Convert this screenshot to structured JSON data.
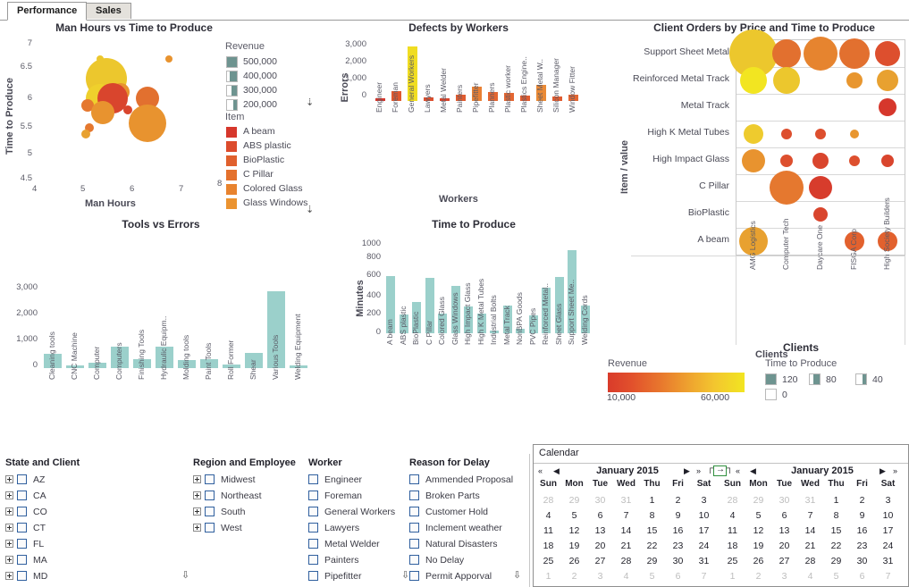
{
  "tabs": [
    {
      "label": "Performance",
      "active": true
    },
    {
      "label": "Sales",
      "active": false
    }
  ],
  "charts": {
    "bubble_scatter": {
      "title": "Man Hours vs Time to Produce",
      "xlabel": "Man Hours",
      "ylabel": "Time to Produce",
      "xticks": [
        "4",
        "5",
        "6",
        "7",
        "8"
      ],
      "yticks": [
        "7",
        "6.5",
        "6",
        "5.5",
        "5",
        "4.5"
      ],
      "legend_revenue_title": "Revenue",
      "legend_revenue": [
        "500,000",
        "400,000",
        "300,000",
        "200,000"
      ],
      "legend_item_title": "Item",
      "legend_items": [
        {
          "label": "A beam",
          "color": "#d6372c"
        },
        {
          "label": "ABS plastic",
          "color": "#dc4b2c"
        },
        {
          "label": "BioPlastic",
          "color": "#e0602d"
        },
        {
          "label": "C Pillar",
          "color": "#e4712d"
        },
        {
          "label": "Colored Glass",
          "color": "#e8832e"
        },
        {
          "label": "Glass Windows",
          "color": "#eb9330"
        }
      ]
    },
    "defects": {
      "title": "Defects by Workers",
      "xlabel": "Workers",
      "ylabel": "Errors",
      "yticks": [
        "3,000",
        "2,000",
        "1,000",
        "0"
      ],
      "categories": [
        "Engineer",
        "Foreman",
        "General Workers",
        "Lawyers",
        "Metal Welder",
        "Painters",
        "Pipefitter",
        "Planners",
        "Plastic worker",
        "Plastics Engine..",
        "Sheet Metal W..",
        "Silicon Manager",
        "Window Fitter"
      ],
      "values": [
        130,
        500,
        2880,
        190,
        140,
        330,
        750,
        480,
        440,
        300,
        840,
        220,
        330
      ],
      "colors": [
        "#d6372c",
        "#df5930",
        "#f0dd22",
        "#dd4f2e",
        "#d9452d",
        "#e05c30",
        "#e98034",
        "#e36632",
        "#e36632",
        "#e05c30",
        "#ea8a36",
        "#e05c30",
        "#e36632"
      ]
    },
    "tools": {
      "title": "Tools vs Errors",
      "yticks": [
        "3,000",
        "2,000",
        "1,000",
        "0"
      ],
      "categories": [
        "Cleaning tools",
        "CNC Machine",
        "Computer",
        "Computers",
        "Finishing Tools",
        "Hydraulic Equipm..",
        "Molding tools",
        "Paint Tools",
        "Roll Former",
        "Shear",
        "Various Tools",
        "Welding Equipment"
      ],
      "values": [
        540,
        60,
        210,
        780,
        330,
        780,
        290,
        330,
        120,
        550,
        2840,
        70
      ],
      "color": "#9bd0cb"
    },
    "time_to_produce": {
      "title": "Time to Produce",
      "ylabel": "Minutes",
      "yticks": [
        "1000",
        "800",
        "600",
        "400",
        "200",
        "0"
      ],
      "categories": [
        "A beam",
        "ABS plastic",
        "BioPlastic",
        "C Pillar",
        "Colored Glass",
        "Glass Windows",
        "High Impact Glass",
        "High K Metal Tubes",
        "Industrial Bolts",
        "Metal Track",
        "NonBPA Goods",
        "PVC Pipes",
        "Reinforced Metal..",
        "Sheet Glass",
        "Support Sheet Me..",
        "Welding Cords"
      ],
      "values": [
        620,
        200,
        335,
        605,
        215,
        510,
        290,
        215,
        30,
        300,
        50,
        190,
        500,
        615,
        900,
        300
      ],
      "color": "#9bd0cb"
    },
    "client_matrix": {
      "title": "Client Orders by Price and Time to Produce",
      "ylabel": "Item / value",
      "xlabel": "Clients",
      "rows": [
        "Support Sheet Metal",
        "Reinforced Metal Track",
        "Metal Track",
        "High K Metal Tubes",
        "High Impact Glass",
        "C Pillar",
        "BioPlastic",
        "A beam"
      ],
      "columns": [
        "AMG Logistics",
        "Computer Tech",
        "Daycare One",
        "FISGA Corp",
        "High Society Builders"
      ],
      "cells": [
        [
          {
            "r": 27,
            "c": "#ecc72d"
          },
          {
            "r": 16,
            "c": "#e2702f"
          },
          {
            "r": 19,
            "c": "#e6842f"
          },
          {
            "r": 17,
            "c": "#e2702f"
          },
          {
            "r": 14,
            "c": "#dd4f2e"
          }
        ],
        [
          {
            "r": 15,
            "c": "#f2e521"
          },
          {
            "r": 15,
            "c": "#ecc72d"
          },
          null,
          {
            "r": 9,
            "c": "#e8962f"
          },
          {
            "r": 12,
            "c": "#e8a130"
          }
        ],
        [
          null,
          null,
          null,
          null,
          {
            "r": 10,
            "c": "#d6372c"
          }
        ],
        [
          {
            "r": 11,
            "c": "#eecb2e"
          },
          {
            "r": 6,
            "c": "#dd4f2e"
          },
          {
            "r": 6,
            "c": "#dd4f2e"
          },
          {
            "r": 5,
            "c": "#e8962f"
          },
          null
        ],
        [
          {
            "r": 13,
            "c": "#e8932f"
          },
          {
            "r": 7,
            "c": "#dd4f2e"
          },
          {
            "r": 9,
            "c": "#d9452d"
          },
          {
            "r": 6,
            "c": "#dd4f2e"
          },
          {
            "r": 7,
            "c": "#d9452d"
          }
        ],
        [
          null,
          {
            "r": 19,
            "c": "#e5782f"
          },
          {
            "r": 13,
            "c": "#d73c2c"
          },
          null,
          null
        ],
        [
          null,
          null,
          {
            "r": 8,
            "c": "#d9452d"
          },
          null,
          null
        ],
        [
          {
            "r": 16,
            "c": "#e8a130"
          },
          null,
          null,
          {
            "r": 11,
            "c": "#e2612e"
          },
          {
            "r": 11,
            "c": "#e2612e"
          }
        ]
      ]
    }
  },
  "legend": {
    "revenue_title": "Revenue",
    "revenue_min": "10,000",
    "revenue_max": "60,000",
    "clients_title": "Clients",
    "ttp_title": "Time to Produce",
    "ttp_values": [
      "120",
      "80",
      "40",
      "0"
    ]
  },
  "filters": [
    {
      "title": "State and Client",
      "expandable": true,
      "items": [
        "AZ",
        "CA",
        "CO",
        "CT",
        "FL",
        "MA",
        "MD"
      ]
    },
    {
      "title": "Region and Employee",
      "expandable": true,
      "items": [
        "Midwest",
        "Northeast",
        "South",
        "West"
      ]
    },
    {
      "title": "Worker",
      "expandable": false,
      "items": [
        "Engineer",
        "Foreman",
        "General Workers",
        "Lawyers",
        "Metal Welder",
        "Painters",
        "Pipefitter"
      ]
    },
    {
      "title": "Reason for Delay",
      "expandable": false,
      "items": [
        "Ammended Proposal",
        "Broken Parts",
        "Customer Hold",
        "Inclement weather",
        "Natural Disasters",
        "No Delay",
        "Permit Apporval"
      ]
    }
  ],
  "calendar": {
    "title": "Calendar",
    "month_left": "January 2015",
    "month_right": "January 2015",
    "dow": [
      "Sun",
      "Mon",
      "Tue",
      "Wed",
      "Thu",
      "Fri",
      "Sat"
    ],
    "weeks": [
      [
        {
          "d": "28",
          "m": true
        },
        {
          "d": "29",
          "m": true
        },
        {
          "d": "30",
          "m": true
        },
        {
          "d": "31",
          "m": true
        },
        {
          "d": "1",
          "m": false
        },
        {
          "d": "2",
          "m": false
        },
        {
          "d": "3",
          "m": false
        }
      ],
      [
        {
          "d": "4",
          "m": false
        },
        {
          "d": "5",
          "m": false
        },
        {
          "d": "6",
          "m": false
        },
        {
          "d": "7",
          "m": false
        },
        {
          "d": "8",
          "m": false
        },
        {
          "d": "9",
          "m": false
        },
        {
          "d": "10",
          "m": false
        }
      ],
      [
        {
          "d": "11",
          "m": false
        },
        {
          "d": "12",
          "m": false
        },
        {
          "d": "13",
          "m": false
        },
        {
          "d": "14",
          "m": false
        },
        {
          "d": "15",
          "m": false
        },
        {
          "d": "16",
          "m": false
        },
        {
          "d": "17",
          "m": false
        }
      ],
      [
        {
          "d": "18",
          "m": false
        },
        {
          "d": "19",
          "m": false
        },
        {
          "d": "20",
          "m": false
        },
        {
          "d": "21",
          "m": false
        },
        {
          "d": "22",
          "m": false
        },
        {
          "d": "23",
          "m": false
        },
        {
          "d": "24",
          "m": false
        }
      ],
      [
        {
          "d": "25",
          "m": false
        },
        {
          "d": "26",
          "m": false
        },
        {
          "d": "27",
          "m": false
        },
        {
          "d": "28",
          "m": false
        },
        {
          "d": "29",
          "m": false
        },
        {
          "d": "30",
          "m": false
        },
        {
          "d": "31",
          "m": false
        }
      ],
      [
        {
          "d": "1",
          "m": true
        },
        {
          "d": "2",
          "m": true
        },
        {
          "d": "3",
          "m": true
        },
        {
          "d": "4",
          "m": true
        },
        {
          "d": "5",
          "m": true
        },
        {
          "d": "6",
          "m": true
        },
        {
          "d": "7",
          "m": true
        }
      ]
    ],
    "nav": {
      "first": "«",
      "prev": "◀",
      "next": "▶",
      "last": "»"
    }
  },
  "chart_data": [
    {
      "type": "scatter",
      "title": "Man Hours vs Time to Produce",
      "xlabel": "Man Hours",
      "ylabel": "Time to Produce",
      "xlim": [
        4,
        8
      ],
      "ylim": [
        4.5,
        7
      ],
      "size_encodes": "Revenue",
      "color_encodes": "Item",
      "points": [
        {
          "x": 5.52,
          "y": 6.62,
          "r": 4,
          "color": "#ecc72d"
        },
        {
          "x": 6.95,
          "y": 6.62,
          "r": 4,
          "color": "#e8932f"
        },
        {
          "x": 5.65,
          "y": 6.28,
          "r": 23,
          "color": "#ecc72d"
        },
        {
          "x": 5.95,
          "y": 6.04,
          "r": 10,
          "color": "#e8932f"
        },
        {
          "x": 5.52,
          "y": 5.93,
          "r": 16,
          "color": "#efd02c"
        },
        {
          "x": 5.78,
          "y": 5.93,
          "r": 17,
          "color": "#d9452d"
        },
        {
          "x": 6.52,
          "y": 5.93,
          "r": 13,
          "color": "#e2702f"
        },
        {
          "x": 5.27,
          "y": 5.82,
          "r": 7,
          "color": "#e5782f"
        },
        {
          "x": 6.1,
          "y": 5.73,
          "r": 5,
          "color": "#d9452d"
        },
        {
          "x": 5.58,
          "y": 5.68,
          "r": 13,
          "color": "#e8932f"
        },
        {
          "x": 6.52,
          "y": 5.5,
          "r": 21,
          "color": "#e8932f"
        },
        {
          "x": 5.3,
          "y": 5.42,
          "r": 5,
          "color": "#e5782f"
        },
        {
          "x": 5.22,
          "y": 5.32,
          "r": 5,
          "color": "#e8a130"
        }
      ]
    },
    {
      "type": "bar",
      "title": "Defects by Workers",
      "xlabel": "Workers",
      "ylabel": "Errors",
      "ylim": [
        0,
        3000
      ],
      "categories": [
        "Engineer",
        "Foreman",
        "General Workers",
        "Lawyers",
        "Metal Welder",
        "Painters",
        "Pipefitter",
        "Planners",
        "Plastic worker",
        "Plastics Engine..",
        "Sheet Metal W..",
        "Silicon Manager",
        "Window Fitter"
      ],
      "values": [
        130,
        500,
        2880,
        190,
        140,
        330,
        750,
        480,
        440,
        300,
        840,
        220,
        330
      ]
    },
    {
      "type": "bar",
      "title": "Tools vs Errors",
      "xlabel": "",
      "ylabel": "",
      "ylim": [
        0,
        3000
      ],
      "categories": [
        "Cleaning tools",
        "CNC Machine",
        "Computer",
        "Computers",
        "Finishing Tools",
        "Hydraulic Equipm..",
        "Molding tools",
        "Paint Tools",
        "Roll Former",
        "Shear",
        "Various Tools",
        "Welding Equipment"
      ],
      "values": [
        540,
        60,
        210,
        780,
        330,
        780,
        290,
        330,
        120,
        550,
        2840,
        70
      ]
    },
    {
      "type": "bar",
      "title": "Time to Produce",
      "xlabel": "",
      "ylabel": "Minutes",
      "ylim": [
        0,
        1000
      ],
      "categories": [
        "A beam",
        "ABS plastic",
        "BioPlastic",
        "C Pillar",
        "Colored Glass",
        "Glass Windows",
        "High Impact Glass",
        "High K Metal Tubes",
        "Industrial Bolts",
        "Metal Track",
        "NonBPA Goods",
        "PVC Pipes",
        "Reinforced Metal..",
        "Sheet Glass",
        "Support Sheet Me..",
        "Welding Cords"
      ],
      "values": [
        620,
        200,
        335,
        605,
        215,
        510,
        290,
        215,
        30,
        300,
        50,
        190,
        500,
        615,
        900,
        300
      ]
    },
    {
      "type": "heatmap",
      "title": "Client Orders by Price and Time to Produce",
      "xlabel": "Clients",
      "ylabel": "Item / value",
      "size_encodes": "Time to Produce",
      "color_encodes": "Revenue",
      "color_range": [
        "10,000",
        "60,000"
      ],
      "rows": [
        "Support Sheet Metal",
        "Reinforced Metal Track",
        "Metal Track",
        "High K Metal Tubes",
        "High Impact Glass",
        "C Pillar",
        "BioPlastic",
        "A beam"
      ],
      "columns": [
        "AMG Logistics",
        "Computer Tech",
        "Daycare One",
        "FISGA Corp",
        "High Society Builders"
      ]
    }
  ]
}
